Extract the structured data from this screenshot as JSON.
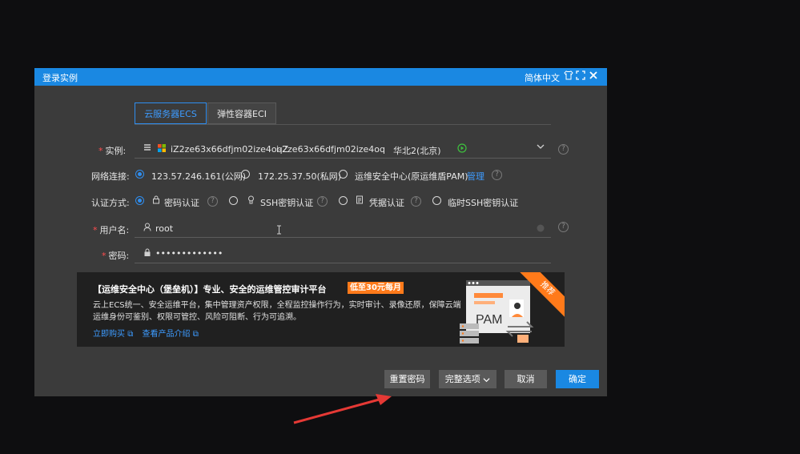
{
  "dialog": {
    "title": "登录实例",
    "language": "简体中文",
    "icons": [
      "shirt-icon",
      "fullscreen-icon",
      "close-icon"
    ]
  },
  "tabs": [
    {
      "label": "云服务器ECS",
      "active": true
    },
    {
      "label": "弹性容器ECI",
      "active": false
    }
  ],
  "instance": {
    "label": "实例:",
    "name": "iZ2ze63x66dfjm02ize4oqZ",
    "id": "i-2ze63x66dfjm02ize4oq",
    "region": "华北2(北京)"
  },
  "network": {
    "label": "网络连接:",
    "options": [
      "123.57.246.161(公网)",
      "172.25.37.50(私网)",
      "运维安全中心(原运维盾PAM)"
    ],
    "manage_link": "管理",
    "selected": 0
  },
  "auth": {
    "label": "认证方式:",
    "options": [
      "密码认证",
      "SSH密钥认证",
      "凭据认证",
      "临时SSH密钥认证"
    ],
    "selected": 0
  },
  "username": {
    "label": "用户名:",
    "value": "root"
  },
  "password": {
    "label": "密码:",
    "value": "•••••••••••••"
  },
  "banner": {
    "title": "【运维安全中心（堡垒机）】专业、安全的运维管控审计平台",
    "badge": "低至30元每月",
    "desc_line1": "云上ECS统一、安全运维平台，集中管理资产权限，全程监控操作行为，实时审计、录像还原，保障云端",
    "desc_line2": "运维身份可鉴别、权限可管控、风险可阻断、行为可追溯。",
    "link_buy": "立即购买",
    "link_intro": "查看产品介绍",
    "ribbon": "推荐",
    "pam": "PAM"
  },
  "buttons": {
    "reset": "重置密码",
    "options": "完整选项",
    "cancel": "取消",
    "confirm": "确定"
  },
  "colors": {
    "accent": "#1a88e2",
    "orange": "#ff7a1a",
    "arrow": "#e53935"
  }
}
